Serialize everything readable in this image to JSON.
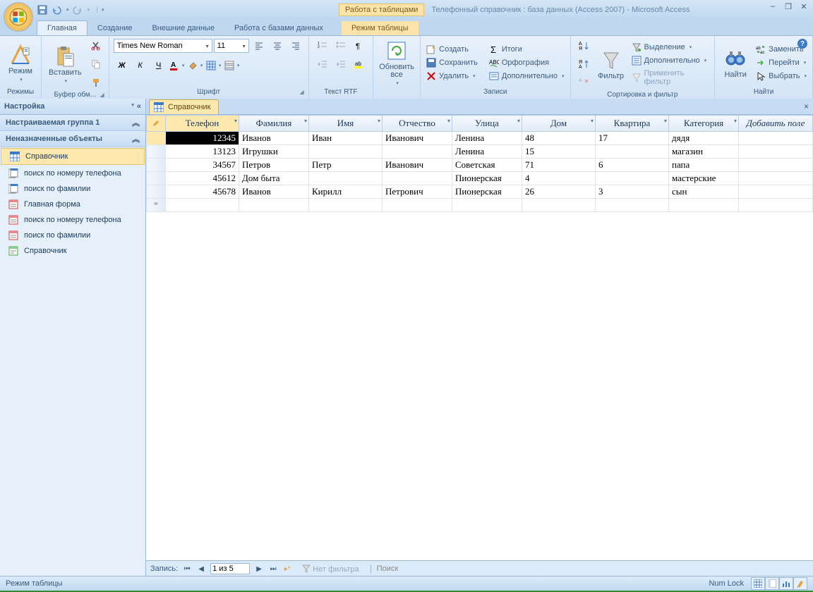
{
  "title": "Телефонный справочник : база данных (Access 2007) - Microsoft Access",
  "contextual_group": "Работа с таблицами",
  "tabs": {
    "home": "Главная",
    "create": "Создание",
    "external": "Внешние данные",
    "dbtools": "Работа с базами данных",
    "datasheet": "Режим таблицы"
  },
  "ribbon": {
    "views": {
      "label": "Режимы",
      "btn": "Режим"
    },
    "clipboard": {
      "label": "Буфер обм...",
      "paste": "Вставить"
    },
    "font": {
      "label": "Шрифт",
      "name": "Times New Roman",
      "size": "11"
    },
    "rtf": {
      "label": "Текст RTF"
    },
    "records": {
      "label": "Записи",
      "refresh": "Обновить все",
      "new": "Создать",
      "save": "Сохранить",
      "delete": "Удалить",
      "totals": "Итоги",
      "spelling": "Орфография",
      "more": "Дополнительно"
    },
    "sortfilter": {
      "label": "Сортировка и фильтр",
      "filter": "Фильтр",
      "selection": "Выделение",
      "advanced": "Дополнительно",
      "toggle": "Применить фильтр"
    },
    "find": {
      "label": "Найти",
      "find_btn": "Найти",
      "replace": "Заменить",
      "goto": "Перейти",
      "select": "Выбрать"
    }
  },
  "nav": {
    "title": "Настройка",
    "group1": "Настраиваемая группа 1",
    "group2": "Неназначенные объекты",
    "items": [
      "Справочник",
      "поиск по номеру телефона",
      "поиск по фамилии",
      "Главная форма",
      "поиск по номеру телефона",
      "поиск по фамилии",
      "Справочник"
    ]
  },
  "doc": {
    "tab": "Справочник",
    "close": "×"
  },
  "columns": [
    "Телефон",
    "Фамилия",
    "Имя",
    "Отчество",
    "Улица",
    "Дом",
    "Квартира",
    "Категория"
  ],
  "add_field": "Добавить поле",
  "rows": [
    {
      "tel": "12345",
      "fam": "Иванов",
      "imya": "Иван",
      "otch": "Иванович",
      "ul": "Ленина",
      "dom": "48",
      "kv": "17",
      "kat": "дядя"
    },
    {
      "tel": "13123",
      "fam": "Игрушки",
      "imya": "",
      "otch": "",
      "ul": "Ленина",
      "dom": "15",
      "kv": "",
      "kat": "магазин"
    },
    {
      "tel": "34567",
      "fam": "Петров",
      "imya": "Петр",
      "otch": "Иванович",
      "ul": "Советская",
      "dom": "71",
      "kv": "6",
      "kat": "папа"
    },
    {
      "tel": "45612",
      "fam": "Дом быта",
      "imya": "",
      "otch": "",
      "ul": "Пионерская",
      "dom": "4",
      "kv": "",
      "kat": "мастерские"
    },
    {
      "tel": "45678",
      "fam": "Иванов",
      "imya": "Кирилл",
      "otch": "Петрович",
      "ul": "Пионерская",
      "dom": "26",
      "kv": "3",
      "kat": "сын"
    }
  ],
  "recnav": {
    "label": "Запись:",
    "pos": "1 из 5",
    "nofilter": "Нет фильтра",
    "search": "Поиск"
  },
  "status": {
    "mode": "Режим таблицы",
    "numlock": "Num Lock"
  }
}
